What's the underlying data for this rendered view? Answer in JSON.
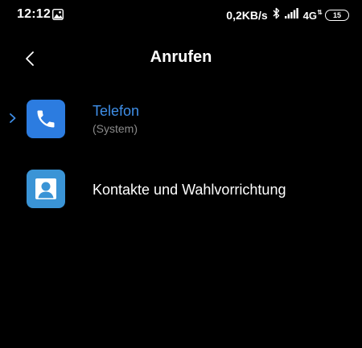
{
  "status_bar": {
    "time": "12:12",
    "speed": "0,2KB/s",
    "network": "4G",
    "battery": "15"
  },
  "header": {
    "title": "Anrufen"
  },
  "apps": [
    {
      "label": "Telefon",
      "sublabel": "(System)",
      "icon": "phone-icon",
      "selected": true,
      "color": "#3f8fe8"
    },
    {
      "label": "Kontakte und Wahlvorrichtung",
      "icon": "contacts-icon",
      "selected": false
    }
  ]
}
